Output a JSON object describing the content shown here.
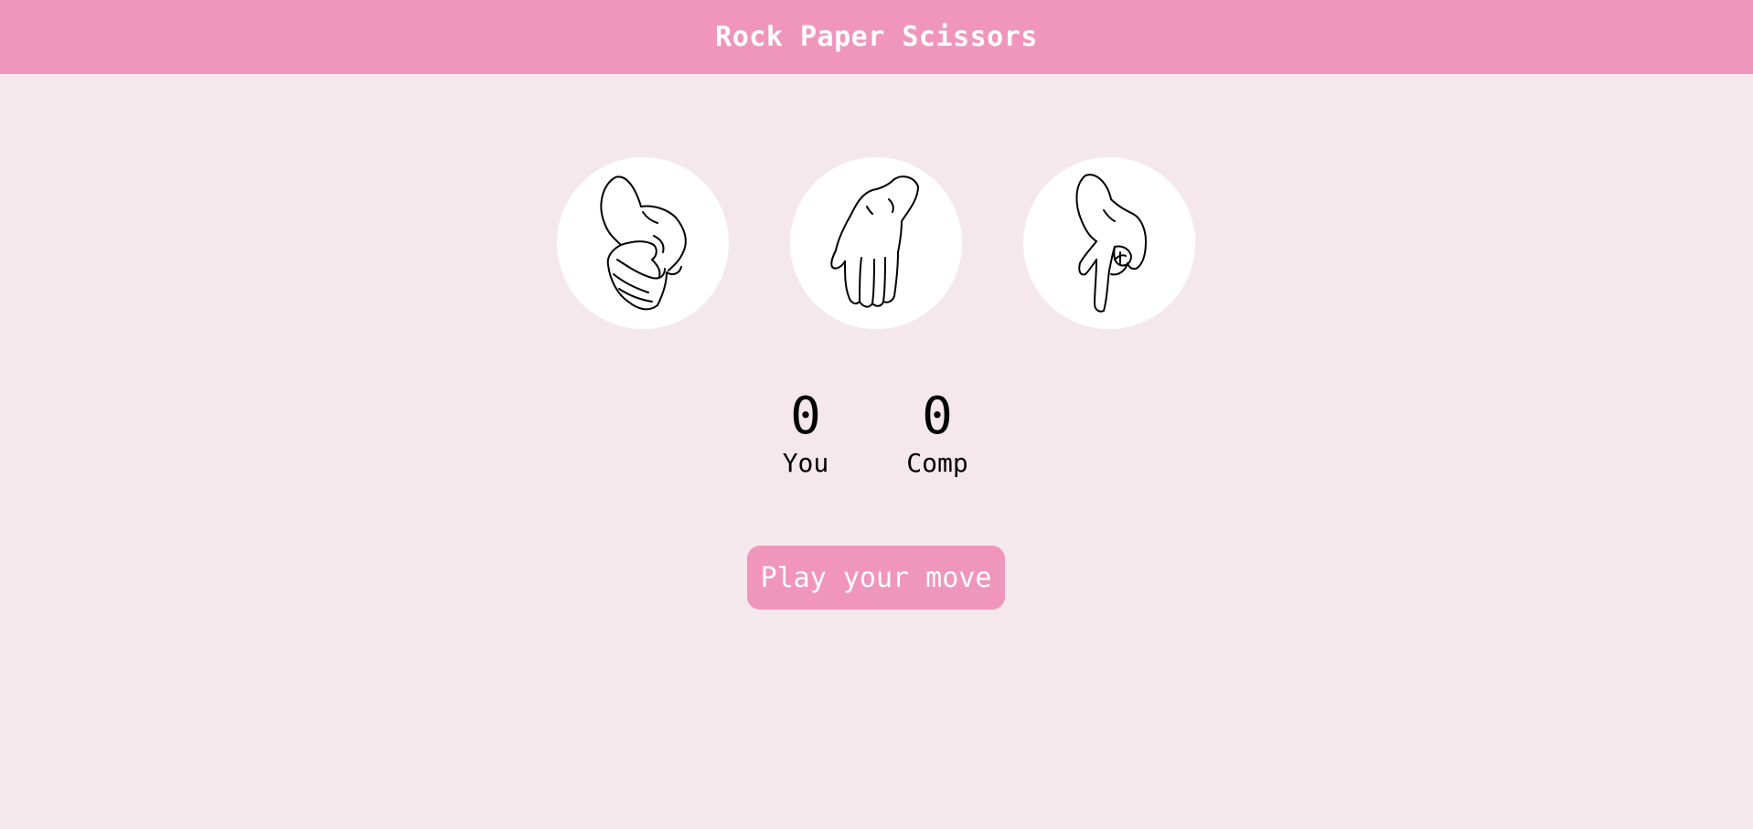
{
  "header": {
    "title": "Rock Paper Scissors"
  },
  "choices": [
    {
      "id": "rock",
      "icon": "rock-fist-icon"
    },
    {
      "id": "paper",
      "icon": "paper-hand-icon"
    },
    {
      "id": "scissors",
      "icon": "scissors-hand-icon"
    }
  ],
  "scores": {
    "you": {
      "value": "0",
      "label": "You"
    },
    "comp": {
      "value": "0",
      "label": "Comp"
    }
  },
  "play_button": {
    "label": "Play your move"
  },
  "colors": {
    "accent": "#f096bc",
    "background": "#f5e8ed",
    "card": "#ffffff",
    "text": "#000000"
  }
}
